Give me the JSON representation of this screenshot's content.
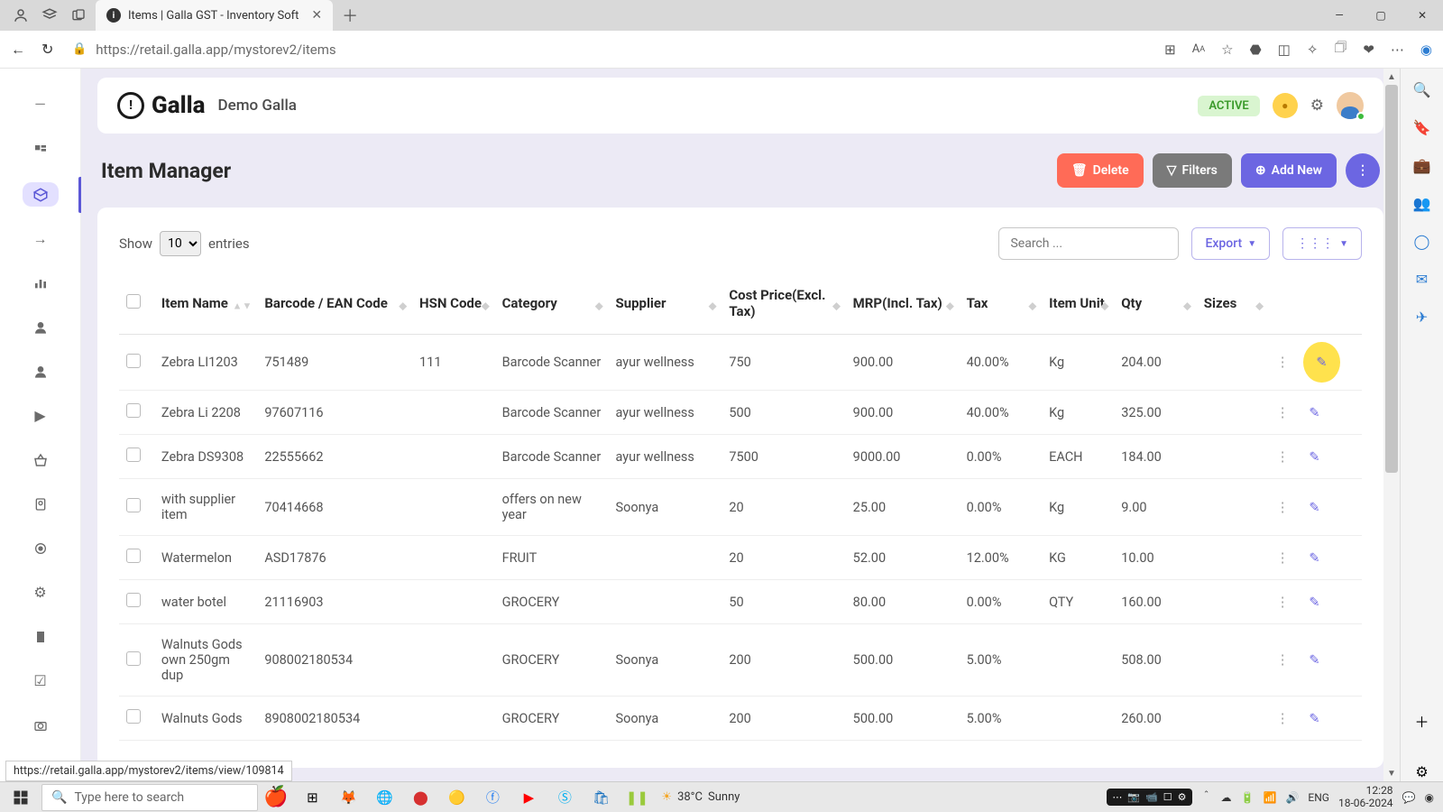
{
  "browser": {
    "tab_title": "Items | Galla GST - Inventory Soft",
    "url": "https://retail.galla.app/mystorev2/items",
    "status_url": "https://retail.galla.app/mystorev2/items/view/109814"
  },
  "header": {
    "brand": "Galla",
    "store": "Demo Galla",
    "status": "ACTIVE"
  },
  "page": {
    "title": "Item Manager",
    "delete": "Delete",
    "filters": "Filters",
    "add_new": "Add New"
  },
  "controls": {
    "show": "Show",
    "entries": "entries",
    "page_size": "10",
    "search_placeholder": "Search ...",
    "export": "Export"
  },
  "columns": [
    "Item Name",
    "Barcode / EAN Code",
    "HSN Code",
    "Category",
    "Supplier",
    "Cost Price(Excl. Tax)",
    "MRP(Incl. Tax)",
    "Tax",
    "Item Unit",
    "Qty",
    "Sizes"
  ],
  "rows": [
    {
      "name": "Zebra LI1203",
      "barcode": "751489",
      "hsn": "111",
      "category": "Barcode Scanner",
      "supplier": "ayur wellness",
      "cost": "750",
      "mrp": "900.00",
      "tax": "40.00%",
      "unit": "Kg",
      "qty": "204.00",
      "sizes": ""
    },
    {
      "name": "Zebra Li 2208",
      "barcode": "97607116",
      "hsn": "",
      "category": "Barcode Scanner",
      "supplier": "ayur wellness",
      "cost": "500",
      "mrp": "900.00",
      "tax": "40.00%",
      "unit": "Kg",
      "qty": "325.00",
      "sizes": ""
    },
    {
      "name": "Zebra DS9308",
      "barcode": "22555662",
      "hsn": "",
      "category": "Barcode Scanner",
      "supplier": "ayur wellness",
      "cost": "7500",
      "mrp": "9000.00",
      "tax": "0.00%",
      "unit": "EACH",
      "qty": "184.00",
      "sizes": ""
    },
    {
      "name": "with supplier item",
      "barcode": "70414668",
      "hsn": "",
      "category": "offers on new year",
      "supplier": "Soonya",
      "cost": "20",
      "mrp": "25.00",
      "tax": "0.00%",
      "unit": "Kg",
      "qty": "9.00",
      "sizes": ""
    },
    {
      "name": "Watermelon",
      "barcode": "ASD17876",
      "hsn": "",
      "category": "FRUIT",
      "supplier": "",
      "cost": "20",
      "mrp": "52.00",
      "tax": "12.00%",
      "unit": "KG",
      "qty": "10.00",
      "sizes": ""
    },
    {
      "name": "water botel",
      "barcode": "21116903",
      "hsn": "",
      "category": "GROCERY",
      "supplier": "",
      "cost": "50",
      "mrp": "80.00",
      "tax": "0.00%",
      "unit": "QTY",
      "qty": "160.00",
      "sizes": ""
    },
    {
      "name": "Walnuts Gods own 250gm dup",
      "barcode": "908002180534",
      "hsn": "",
      "category": "GROCERY",
      "supplier": "Soonya",
      "cost": "200",
      "mrp": "500.00",
      "tax": "5.00%",
      "unit": "",
      "qty": "508.00",
      "sizes": ""
    },
    {
      "name": "Walnuts Gods",
      "barcode": "8908002180534",
      "hsn": "",
      "category": "GROCERY",
      "supplier": "Soonya",
      "cost": "200",
      "mrp": "500.00",
      "tax": "5.00%",
      "unit": "",
      "qty": "260.00",
      "sizes": ""
    }
  ],
  "weather": {
    "temp": "38°C",
    "cond": "Sunny"
  },
  "tray": {
    "lang": "ENG",
    "time": "12:28",
    "date": "18-06-2024"
  },
  "search_task": "Type here to search"
}
